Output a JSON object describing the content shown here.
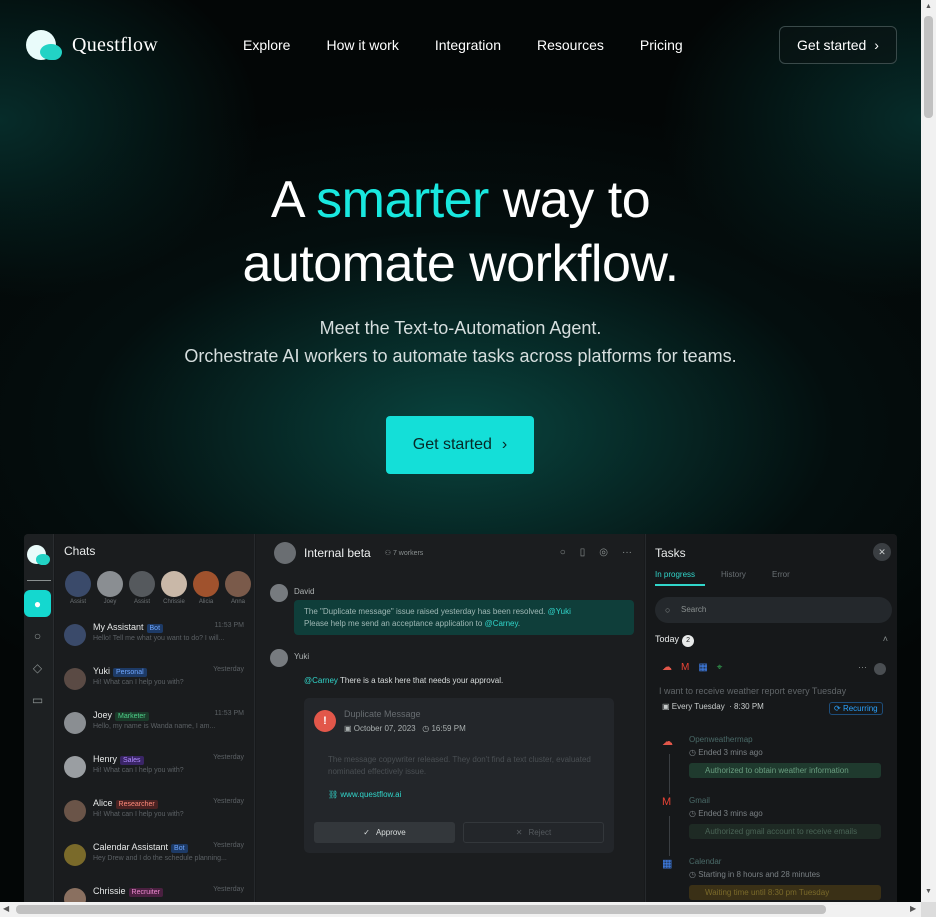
{
  "brand": {
    "name": "Questflow"
  },
  "nav": {
    "items": [
      "Explore",
      "How it work",
      "Integration",
      "Resources",
      "Pricing"
    ],
    "cta": "Get started"
  },
  "hero": {
    "title_pre": "A ",
    "title_accent": "smarter",
    "title_post_line1": " way to",
    "title_line2": "automate workflow.",
    "subtitle_line1": "Meet the Text-to-Automation Agent.",
    "subtitle_line2": "Orchestrate AI workers to automate tasks across platforms for teams.",
    "cta": "Get started"
  },
  "colors": {
    "accent": "#19e8df",
    "cta_bg": "#14dfd8",
    "background": "#030606"
  },
  "app": {
    "chats": {
      "title": "Chats",
      "avatar_labels": [
        "Assist",
        "Joey",
        "Assist",
        "Chrissie",
        "Alicia",
        "Anna"
      ],
      "items": [
        {
          "name": "My Assistant",
          "tag": "Bot",
          "preview": "Hello! Tell me what you want to do? I will...",
          "time": "11:53 PM"
        },
        {
          "name": "Yuki",
          "tag": "Personal",
          "preview": "Hi! What can I help you with?",
          "time": "Yesterday"
        },
        {
          "name": "Joey",
          "tag": "Marketer",
          "preview": "Hello, my name is Wanda name, I am...",
          "time": "11:53 PM"
        },
        {
          "name": "Henry",
          "tag": "Sales",
          "preview": "Hi! What can I help you with?",
          "time": "Yesterday"
        },
        {
          "name": "Alice",
          "tag": "Researcher",
          "preview": "Hi! What can I help you with?",
          "time": "Yesterday"
        },
        {
          "name": "Calendar Assistant",
          "tag": "Bot",
          "preview": "Hey Drew and I do the schedule planning...",
          "time": "Yesterday"
        },
        {
          "name": "Chrissie",
          "tag": "Recruiter",
          "preview": "",
          "time": "Yesterday"
        }
      ]
    },
    "thread": {
      "title": "Internal beta",
      "workers": "7 workers",
      "msg1_name": "David",
      "msg1_text": "The \"Duplicate message\" issue raised yesterday has been resolved.",
      "msg1_mention1": "@Yuki",
      "msg1_text2": "Please help me send an acceptance application to",
      "msg1_mention2": "@Carney",
      "msg2_name": "Yuki",
      "msg2_mention": "@Carney",
      "msg2_text": "There is a task here that needs your approval.",
      "card": {
        "title": "Duplicate Message",
        "date": "October 07, 2023",
        "time": "16:59 PM",
        "body": "The message copywriter released. They don't find a text cluster, evaluated nominated effectively issue.",
        "link": "www.questflow.ai",
        "approve": "Approve",
        "reject": "Reject"
      }
    },
    "tasks": {
      "title": "Tasks",
      "tabs": [
        "In progress",
        "History",
        "Error"
      ],
      "search_placeholder": "Search",
      "group": "Today",
      "group_count": "2",
      "task_title": "I want to receive weather report every Tuesday",
      "schedule_day": "Every Tuesday",
      "schedule_time": "8:30 PM",
      "recurring": "Recurring",
      "steps": [
        {
          "title": "Openweathermap",
          "time": "Ended 3 mins ago",
          "note": "Authorized to obtain weather information"
        },
        {
          "title": "Gmail",
          "time": "Ended 3 mins ago",
          "note": "Authorized gmail account to receive emails"
        },
        {
          "title": "Calendar",
          "time": "Starting in 8 hours and 28 minutes",
          "note": "Waiting time until 8:30 pm Tuesday"
        }
      ]
    }
  }
}
